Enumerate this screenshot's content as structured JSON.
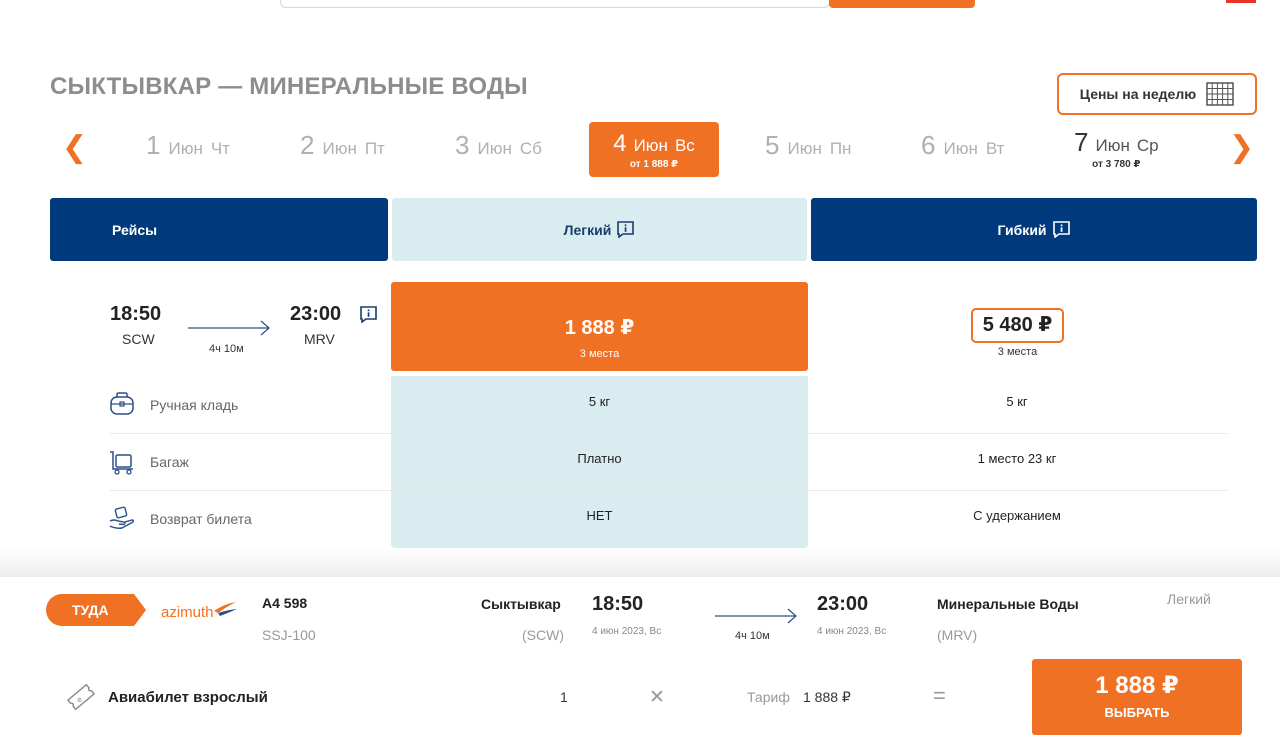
{
  "route": {
    "title": "СЫКТЫВКАР — МИНЕРАЛЬНЫЕ ВОДЫ"
  },
  "week_button": {
    "label": "Цены на неделю"
  },
  "date_nav": {
    "prev": "❮",
    "next": "❯",
    "days": [
      {
        "num": "1",
        "month": "Июн",
        "weekday": "Чт"
      },
      {
        "num": "2",
        "month": "Июн",
        "weekday": "Пт"
      },
      {
        "num": "3",
        "month": "Июн",
        "weekday": "Сб"
      },
      {
        "num": "4",
        "month": "Июн",
        "weekday": "Вс",
        "price": "от 1 888 ₽"
      },
      {
        "num": "5",
        "month": "Июн",
        "weekday": "Пн"
      },
      {
        "num": "6",
        "month": "Июн",
        "weekday": "Вт"
      },
      {
        "num": "7",
        "month": "Июн",
        "weekday": "Ср",
        "price": "от 3 780 ₽"
      }
    ]
  },
  "table": {
    "headers": {
      "flights": "Рейсы",
      "light": "Легкий",
      "flex": "Гибкий"
    },
    "flight": {
      "dep_time": "18:50",
      "dep_code": "SCW",
      "arr_time": "23:00",
      "arr_code": "MRV",
      "duration": "4ч 10м"
    },
    "light": {
      "price": "1 888 ₽",
      "seats": "3 места"
    },
    "flex": {
      "price": "5 480 ₽",
      "seats": "3 места"
    },
    "features": [
      {
        "label": "Ручная кладь",
        "light": "5 кг",
        "flex": "5 кг"
      },
      {
        "label": "Багаж",
        "light": "Платно",
        "flex": "1 место 23 кг"
      },
      {
        "label": "Возврат билета",
        "light": "НЕТ",
        "flex": "С удержанием"
      }
    ]
  },
  "summary": {
    "direction": "ТУДА",
    "airline_logo": "azimuth",
    "flight_no": "A4 598",
    "aircraft": "SSJ-100",
    "from_city": "Сыктывкар",
    "from_code": "(SCW)",
    "dep_time": "18:50",
    "dep_date": "4 июн 2023, Вс",
    "duration": "4ч 10м",
    "arr_time": "23:00",
    "arr_date": "4 июн 2023, Вс",
    "to_city": "Минеральные Воды",
    "to_code": "(MRV)",
    "fare": "Легкий",
    "ticket_label": "Авиабилет взрослый",
    "qty": "1",
    "times": "✕",
    "tariff_label": "Тариф",
    "tariff_value": "1 888 ₽",
    "equals": "=",
    "total": "1 888 ₽",
    "select_label": "ВЫБРАТЬ"
  },
  "colors": {
    "accent": "#f07124",
    "navy": "#003a7c",
    "light_blue": "#d9ecf0"
  }
}
